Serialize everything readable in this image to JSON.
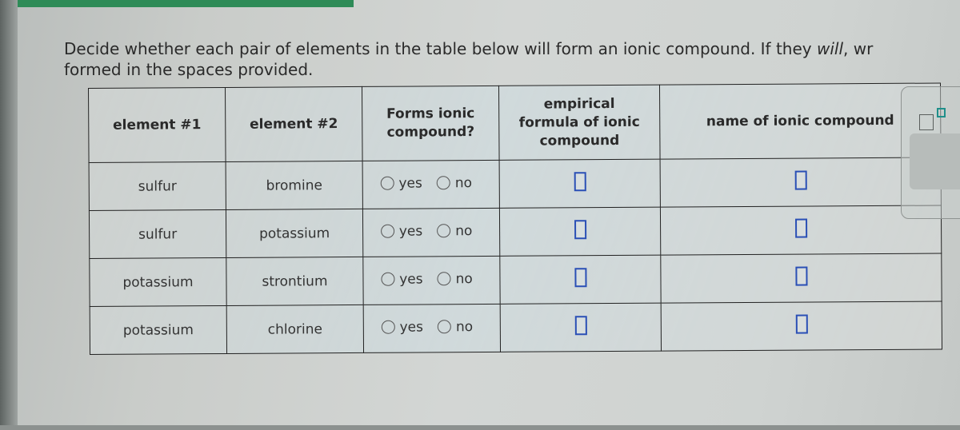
{
  "prompt": {
    "text_before": "Decide whether each pair of elements in the table below will form an ionic compound. If they ",
    "emphasis": "will",
    "text_after": ", wr",
    "line2": "formed in the spaces provided."
  },
  "table": {
    "headers": {
      "element1": "element #1",
      "element2": "element #2",
      "forms_ionic_line1": "Forms ionic",
      "forms_ionic_line2": "compound?",
      "formula_line1": "empirical",
      "formula_line2": "formula of ionic",
      "formula_line3": "compound",
      "name": "name of ionic compound"
    },
    "rows": [
      {
        "element1": "sulfur",
        "element2": "bromine",
        "yes_label": "yes",
        "no_label": "no",
        "formula_value": "",
        "name_value": ""
      },
      {
        "element1": "sulfur",
        "element2": "potassium",
        "yes_label": "yes",
        "no_label": "no",
        "formula_value": "",
        "name_value": ""
      },
      {
        "element1": "potassium",
        "element2": "strontium",
        "yes_label": "yes",
        "no_label": "no",
        "formula_value": "",
        "name_value": ""
      },
      {
        "element1": "potassium",
        "element2": "chlorine",
        "yes_label": "yes",
        "no_label": "no",
        "formula_value": "",
        "name_value": ""
      }
    ]
  },
  "side_panel": {
    "superscript_icon": "superscript-template-icon",
    "next_icon": "chevron-right-icon",
    "next_glyph": "›"
  },
  "colors": {
    "answer_box_border": "#2a4fb5",
    "superscript_accent": "#1f8f8a",
    "top_bar": "#2e8b57"
  }
}
